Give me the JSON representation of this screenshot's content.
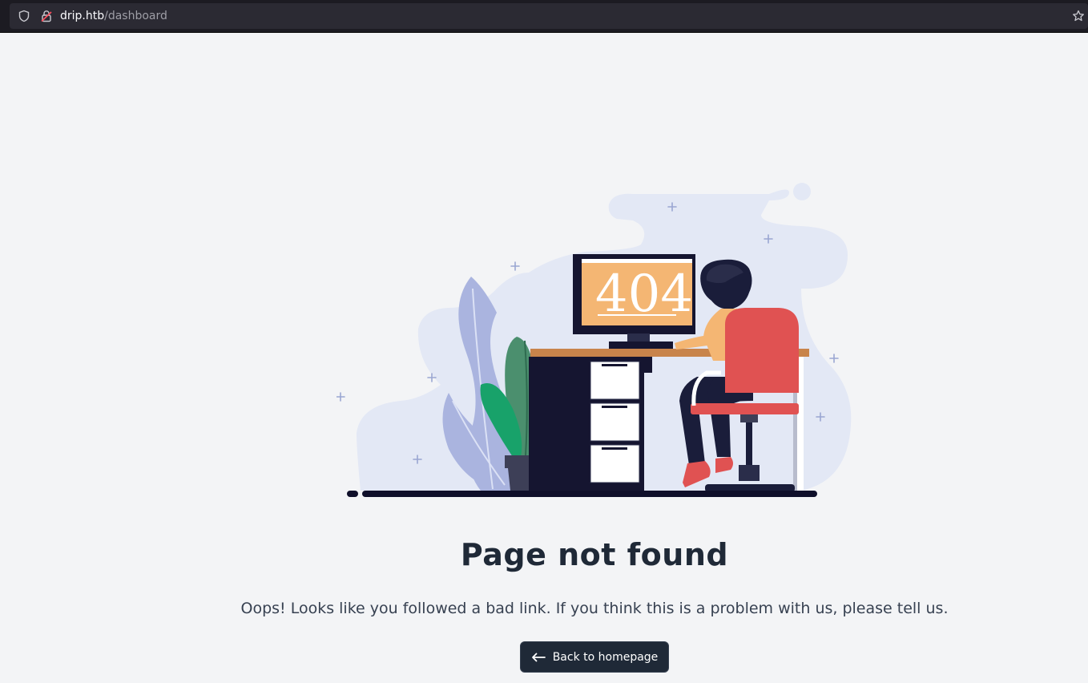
{
  "browser": {
    "url_host": "drip.htb",
    "url_path": "/dashboard"
  },
  "illustration": {
    "screen_text": "404"
  },
  "content": {
    "title": "Page not found",
    "message": "Oops! Looks like you followed a bad link. If you think this is a problem with us, please tell us.",
    "back_button_label": "Back to homepage"
  },
  "colors": {
    "page_background": "#f3f4f6",
    "button_background": "#1f2937",
    "title_text": "#1f2937",
    "screen_orange": "#f4b673",
    "chair_red": "#e05252",
    "plant_green": "#18a26a"
  }
}
